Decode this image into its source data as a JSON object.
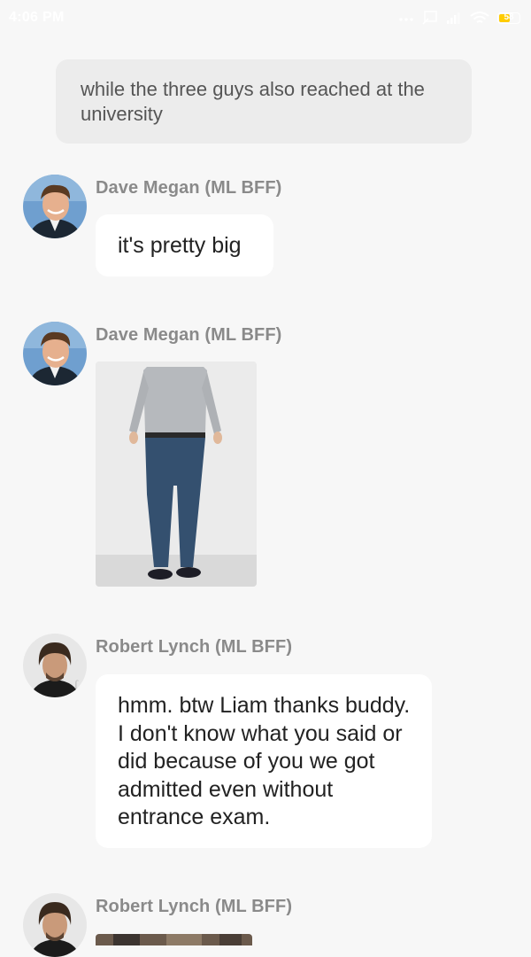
{
  "status_bar": {
    "time": "4:06 PM",
    "battery_level": "58",
    "icons": [
      "signal-dots-icon",
      "screen-mirror-icon",
      "cell-signal-icon",
      "wifi-icon",
      "battery-icon"
    ]
  },
  "system_message": {
    "text": "while the three guys also reached at the university"
  },
  "messages": [
    {
      "sender": "Dave Megan (ML BFF)",
      "type": "text",
      "text": "it's pretty big",
      "avatar": "dave-avatar"
    },
    {
      "sender": "Dave Megan (ML BFF)",
      "type": "image",
      "image_subject": "man in grey sweater and blue trousers",
      "avatar": "dave-avatar"
    },
    {
      "sender": "Robert Lynch (ML BFF)",
      "type": "text",
      "text": "hmm. btw Liam thanks buddy. I don't know what you said or did because of you we got admitted even without entrance exam.",
      "avatar": "robert-avatar"
    },
    {
      "sender": "Robert Lynch (ML BFF)",
      "type": "image",
      "avatar": "robert-avatar"
    }
  ],
  "colors": {
    "background": "#f7f7f7",
    "bubble": "#ffffff",
    "system_bubble": "#ececec",
    "sender_name": "#8a8a8a",
    "message_text": "#222222"
  }
}
